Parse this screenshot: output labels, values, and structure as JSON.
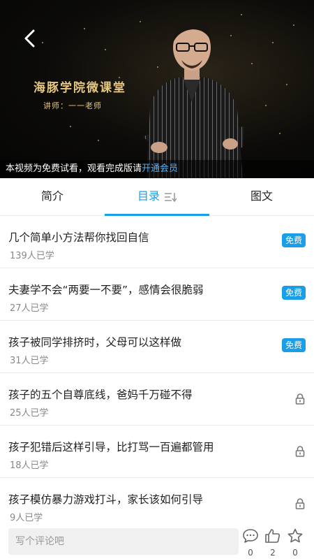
{
  "video": {
    "brand_title": "海豚学院微课堂",
    "lecturer": "讲师：一一老师",
    "trial_text": "本视频为免费试看，观看完成版请",
    "trial_link": "开通会员"
  },
  "tabs": [
    {
      "label": "简介",
      "active": false
    },
    {
      "label": "目录",
      "active": true
    },
    {
      "label": "图文",
      "active": false
    }
  ],
  "lessons": [
    {
      "title": "几个简单小方法帮你找回自信",
      "count": "139人已学",
      "badge": "免费"
    },
    {
      "title": "夫妻学不会“两要一不要”，感情会很脆弱",
      "count": "27人已学",
      "badge": "免费"
    },
    {
      "title": "孩子被同学排挤时，父母可以这样做",
      "count": "31人已学",
      "badge": "免费"
    },
    {
      "title": "孩子的五个自尊底线，爸妈千万碰不得",
      "count": "25人已学",
      "locked": true
    },
    {
      "title": "孩子犯错后这样引导，比打骂一百遍都管用",
      "count": "18人已学",
      "locked": true
    },
    {
      "title": "孩子模仿暴力游戏打斗，家长该如何引导",
      "count": "9人已学",
      "locked": true
    }
  ],
  "bottom": {
    "comment_placeholder": "写个评论吧",
    "comments": "0",
    "likes": "2",
    "favorites": "0"
  },
  "colors": {
    "accent": "#1a9ee8",
    "gold": "#e6c77e"
  }
}
